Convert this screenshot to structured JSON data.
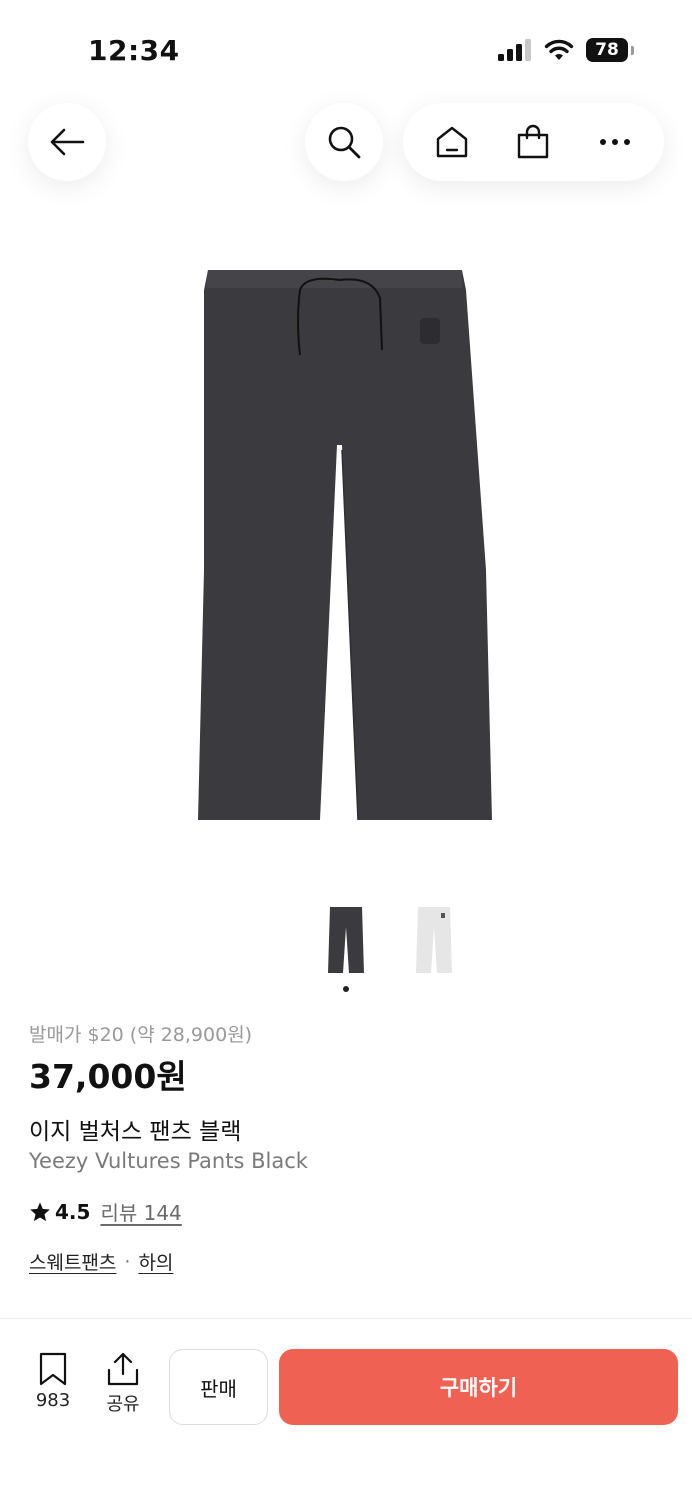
{
  "status_bar": {
    "time": "12:34",
    "battery": "78"
  },
  "nav": {
    "icons": [
      "back-arrow-icon",
      "search-icon",
      "home-icon",
      "shopping-bag-icon",
      "more-icon"
    ]
  },
  "product": {
    "release_price": "발매가 $20 (약 28,900원)",
    "price": "37,000원",
    "name_ko": "이지 벌처스 팬츠 블랙",
    "name_en": "Yeezy Vultures Pants Black",
    "rating": "4.5",
    "review_label": "리뷰 144",
    "tags": [
      "스웨트팬츠",
      "하의"
    ],
    "tag_separator": "·",
    "thumbnails": [
      {
        "color": "black",
        "selected": true
      },
      {
        "color": "white",
        "selected": false
      }
    ]
  },
  "bottom_bar": {
    "bookmark_count": "983",
    "share_label": "공유",
    "sell_label": "판매",
    "buy_label": "구매하기"
  },
  "colors": {
    "accent": "#ef6253",
    "pants": "#3b3b3f",
    "text_muted": "#9a9a9a"
  }
}
